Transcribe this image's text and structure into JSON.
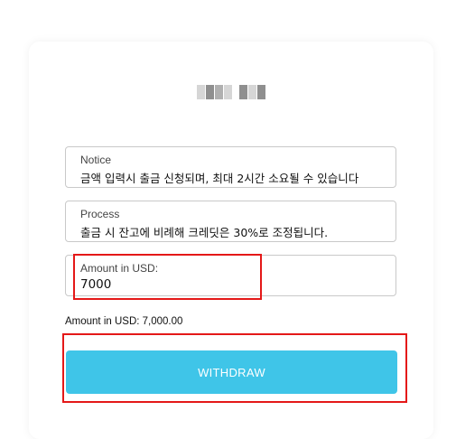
{
  "form": {
    "notice": {
      "label": "Notice",
      "value": "금액 입력시 출금 신청되며, 최대 2시간 소요될 수 있습니다"
    },
    "process": {
      "label": "Process",
      "value": "출금 시 잔고에 비례해 크레딧은 30%로 조정됩니다."
    },
    "amount": {
      "label": "Amount in USD:",
      "value": "7000"
    },
    "summary": "Amount in USD: 7,000.00",
    "withdraw_label": "WITHDRAW"
  },
  "colors": {
    "button": "#3fc5e8",
    "highlight": "#e41818"
  }
}
